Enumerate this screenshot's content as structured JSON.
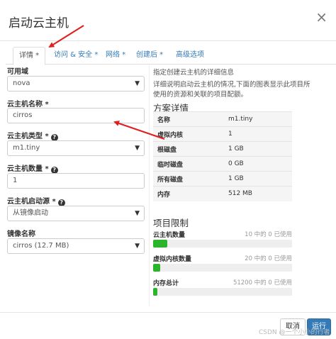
{
  "header": {
    "title": "启动云主机",
    "close": "×"
  },
  "tabs": [
    {
      "label": "详情 *"
    },
    {
      "label": "访问 & 安全 *"
    },
    {
      "label": "网络 *"
    },
    {
      "label": "创建后 *"
    },
    {
      "label": "高级选项"
    }
  ],
  "form": {
    "availability_zone": {
      "label": "可用域",
      "value": "nova"
    },
    "instance_name": {
      "label": "云主机名称 *",
      "value": "cirros"
    },
    "flavor": {
      "label": "云主机类型 *",
      "value": "m1.tiny"
    },
    "count": {
      "label": "云主机数量 *",
      "value": "1"
    },
    "boot_source": {
      "label": "云主机启动源 *",
      "value": "从镜像启动"
    },
    "image": {
      "label": "镜像名称",
      "value": "cirros (12.7 MB)"
    }
  },
  "info": {
    "intro": "指定创建云主机的详细信息",
    "description": "详细说明启动云主机的情况,下面的图表显示此项目所使用的资源和关联的项目配额。",
    "flavor_title": "方案详情",
    "flavor_rows": [
      {
        "k": "名称",
        "v": "m1.tiny"
      },
      {
        "k": "虚拟内核",
        "v": "1"
      },
      {
        "k": "根磁盘",
        "v": "1 GB"
      },
      {
        "k": "临时磁盘",
        "v": "0 GB"
      },
      {
        "k": "所有磁盘",
        "v": "1 GB"
      },
      {
        "k": "内存",
        "v": "512 MB"
      }
    ],
    "limits_title": "项目限制",
    "limits": [
      {
        "name": "云主机数量",
        "usage": "10 中的 0 已使用",
        "fill": 0.1
      },
      {
        "name": "虚拟内核数量",
        "usage": "20 中的 0 已使用",
        "fill": 0.05
      },
      {
        "name": "内存总计",
        "usage": "51200 中的 0 已使用",
        "fill": 0.01
      }
    ]
  },
  "footer": {
    "cancel": "取消",
    "launch": "运行",
    "watermark": "CSDN @一个小小的行者"
  },
  "colors": {
    "primary": "#337ab7",
    "bar_fill": "#2bb52b",
    "arrow": "#e02020"
  }
}
